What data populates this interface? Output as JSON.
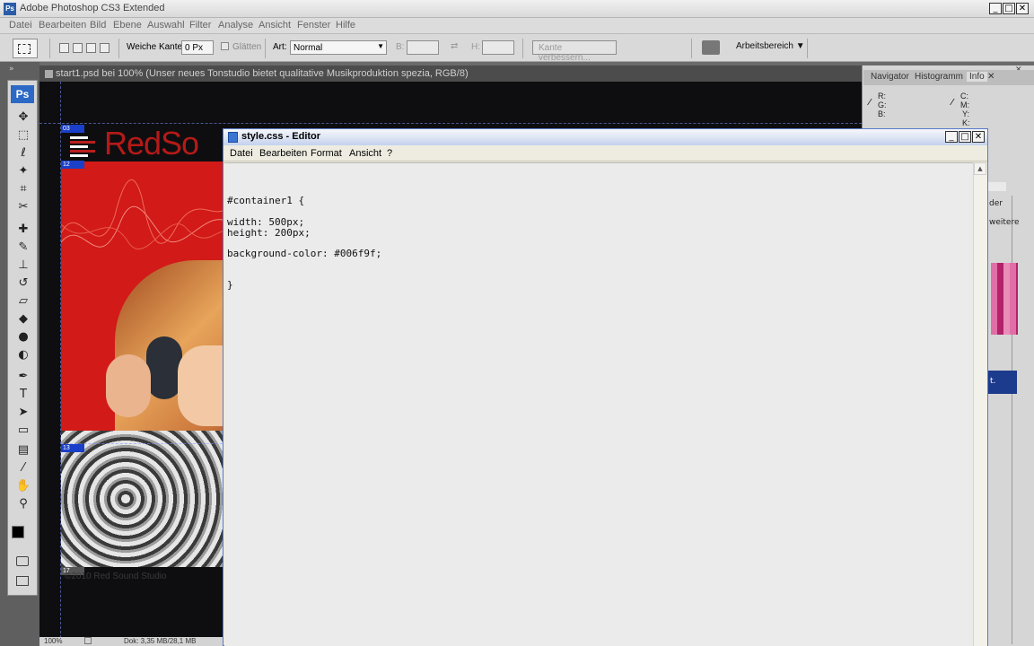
{
  "app": {
    "title": "Adobe Photoshop CS3 Extended",
    "logo": "Ps"
  },
  "window_buttons": {
    "minimize": "_",
    "maximize": "□",
    "close": "✕"
  },
  "menubar": [
    "Datei",
    "Bearbeiten",
    "Bild",
    "Ebene",
    "Auswahl",
    "Filter",
    "Analyse",
    "Ansicht",
    "Fenster",
    "Hilfe"
  ],
  "options": {
    "feather_label": "Weiche Kante:",
    "feather_value": "0 Px",
    "antialias_label": "Glätten",
    "style_label": "Art:",
    "style_value": "Normal",
    "width_label": "B:",
    "height_label": "H:",
    "refine_edge": "Kante verbessern...",
    "workspace": "Arbeitsbereich ▼"
  },
  "toolbox": {
    "badge": "Ps",
    "tools": [
      {
        "name": "move-tool-icon",
        "glyph": "✥"
      },
      {
        "name": "marquee-tool-icon",
        "glyph": "⬚"
      },
      {
        "name": "lasso-tool-icon",
        "glyph": "ℓ"
      },
      {
        "name": "magic-wand-tool-icon",
        "glyph": "✦"
      },
      {
        "name": "crop-tool-icon",
        "glyph": "⌗"
      },
      {
        "name": "slice-tool-icon",
        "glyph": "✂"
      },
      {
        "name": "healing-brush-tool-icon",
        "glyph": "✚"
      },
      {
        "name": "brush-tool-icon",
        "glyph": "✎"
      },
      {
        "name": "clone-stamp-tool-icon",
        "glyph": "⊥"
      },
      {
        "name": "history-brush-tool-icon",
        "glyph": "↺"
      },
      {
        "name": "eraser-tool-icon",
        "glyph": "▱"
      },
      {
        "name": "paint-bucket-tool-icon",
        "glyph": "◆"
      },
      {
        "name": "blur-tool-icon",
        "glyph": "●"
      },
      {
        "name": "dodge-tool-icon",
        "glyph": "◐"
      },
      {
        "name": "pen-tool-icon",
        "glyph": "✒"
      },
      {
        "name": "type-tool-icon",
        "glyph": "T"
      },
      {
        "name": "path-selection-tool-icon",
        "glyph": "➤"
      },
      {
        "name": "shape-tool-icon",
        "glyph": "▭"
      },
      {
        "name": "notes-tool-icon",
        "glyph": "▤"
      },
      {
        "name": "eyedropper-tool-icon",
        "glyph": "⁄"
      },
      {
        "name": "hand-tool-icon",
        "glyph": "✋"
      },
      {
        "name": "zoom-tool-icon",
        "glyph": "⚲"
      }
    ]
  },
  "document": {
    "title": "start1.psd bei 100% (Unser neues Tonstudio bietet qualitative Musikproduktion spezia, RGB/8)",
    "logo_text": "RedSo",
    "slices": [
      "03",
      "12",
      "13",
      "17"
    ],
    "footer_text": "©2010 Red Sound Studio",
    "zoom": "100%",
    "doc_size": "Dok: 3,35 MB/28,1 MB"
  },
  "panels": {
    "tabs": [
      "Navigator",
      "Histogramm",
      "Info"
    ],
    "info_left": [
      "R:",
      "G:",
      "B:"
    ],
    "info_right": [
      "C:",
      "M:",
      "Y:",
      "K:"
    ],
    "side_labels": [
      "der",
      "weitere"
    ]
  },
  "notepad": {
    "title": "style.css - Editor",
    "menu": [
      "Datei",
      "Bearbeiten",
      "Format",
      "Ansicht",
      "?"
    ],
    "lines": {
      "selector": "#container1 {",
      "width": "width: 500px;",
      "height": "height: 200px;",
      "bg": "background-color: #006f9f;",
      "close": "}"
    }
  },
  "colors": {
    "art_red": "#d21a18",
    "ps_blue": "#2c69c4"
  }
}
